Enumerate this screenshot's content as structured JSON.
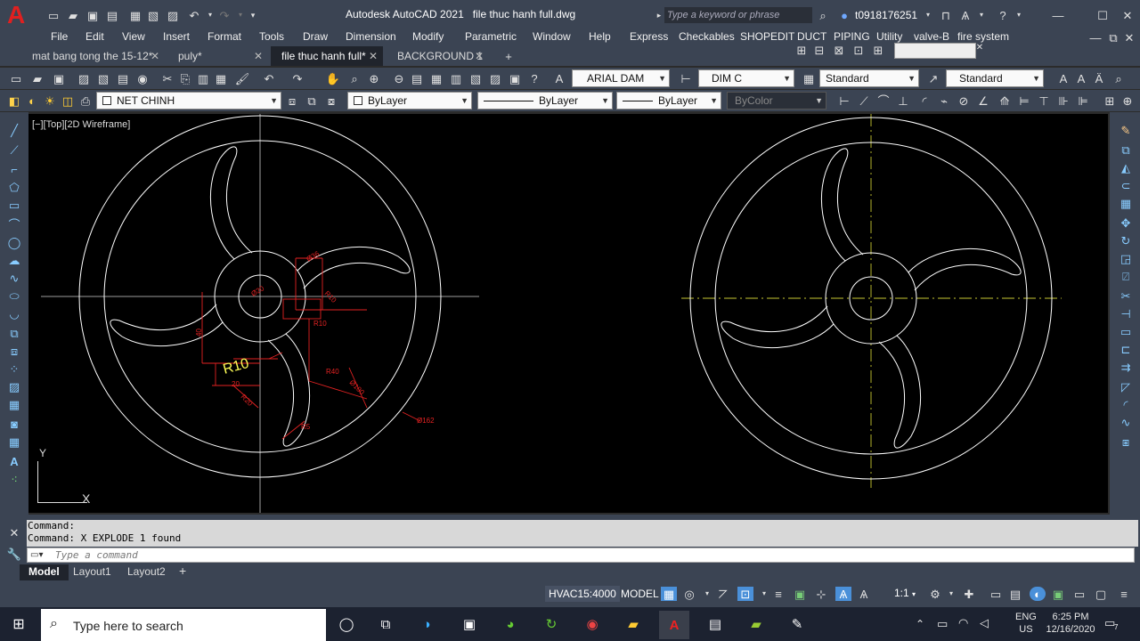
{
  "app": {
    "logo": "A",
    "title": "Autodesk AutoCAD 2021",
    "filename": "file thuc hanh full.dwg",
    "search_placeholder": "Type a keyword or phrase",
    "user": "t0918176251"
  },
  "menu": [
    "File",
    "Edit",
    "View",
    "Insert",
    "Format",
    "Tools",
    "Draw",
    "Dimension",
    "Modify",
    "Parametric",
    "Window",
    "Help",
    "Express",
    "Checkables",
    "SHOPEDIT",
    "DUCT",
    "PIPING",
    "Utility",
    "valve-B",
    "fire system"
  ],
  "doc_tabs": [
    {
      "label": "mat bang tong the 15-12*",
      "active": false
    },
    {
      "label": "puly*",
      "active": false
    },
    {
      "label": "file thuc hanh full*",
      "active": true
    },
    {
      "label": "BACKGROUND 1",
      "active": false
    }
  ],
  "toolbar": {
    "text_style": "ARIAL DAM",
    "dim_style": "DIM C",
    "table_style": "Standard",
    "multileader_style": "Standard",
    "layer": "NET CHINH",
    "color": "ByLayer",
    "linetype": "ByLayer",
    "lineweight": "ByLayer",
    "plotstyle": "ByColor"
  },
  "viewport": {
    "label": "[−][Top][2D Wireframe]",
    "ucs_y": "Y",
    "ucs_x": "X"
  },
  "drawing": {
    "dims": [
      "Ø36",
      "R10",
      "Ø20",
      "R10",
      "40",
      "R10",
      "20",
      "R20",
      "R40",
      "Ø100",
      "Ø162",
      "R5"
    ]
  },
  "command": {
    "history": [
      "Command:",
      "Command: X EXPLODE 1 found"
    ],
    "placeholder": "Type a command"
  },
  "layout_tabs": [
    "Model",
    "Layout1",
    "Layout2"
  ],
  "status": {
    "annoscale": "HVAC15:4000",
    "space": "MODEL",
    "scale": "1:1"
  },
  "taskbar": {
    "search": "Type here to search",
    "lang": "ENG",
    "region": "US",
    "time": "6:25 PM",
    "date": "12/16/2020",
    "notif": "7"
  }
}
